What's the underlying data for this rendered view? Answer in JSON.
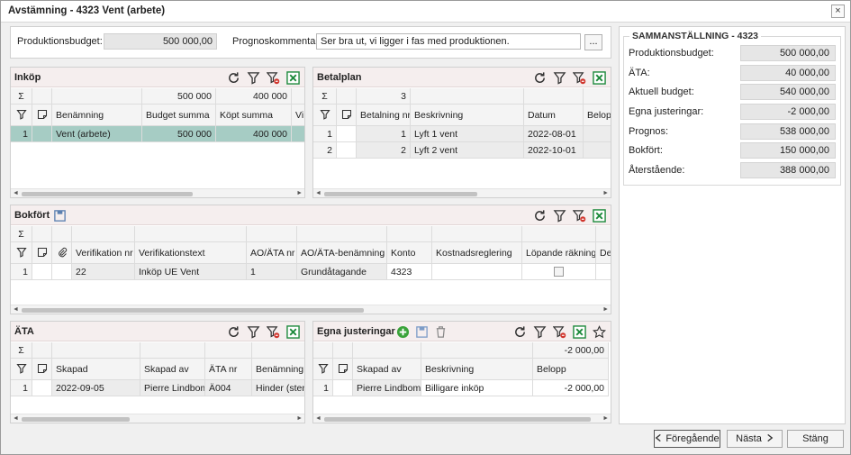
{
  "window": {
    "title": "Avstämning - 4323 Vent (arbete)",
    "close": "×"
  },
  "top": {
    "budget_label": "Produktionsbudget:",
    "budget_value": "500 000,00",
    "comment_label": "Prognoskommentar:",
    "comment_value": "Ser bra ut, vi ligger i fas med produktionen.",
    "dots": "..."
  },
  "inkop": {
    "title": "Inköp",
    "sums": {
      "budget": "500 000",
      "kopt": "400 000"
    },
    "headers": [
      "Benämning",
      "Budget summa",
      "Köpt summa",
      "Vi"
    ],
    "rows": [
      {
        "n": "1",
        "benamning": "Vent (arbete)",
        "budget": "500 000",
        "kopt": "400 000"
      }
    ]
  },
  "betalplan": {
    "title": "Betalplan",
    "count": "3",
    "headers": [
      "Betalning nr",
      "Beskrivning",
      "Datum",
      "Belop"
    ],
    "rows": [
      {
        "n": "1",
        "nr": "1",
        "besk": "Lyft 1 vent",
        "datum": "2022-08-01"
      },
      {
        "n": "2",
        "nr": "2",
        "besk": "Lyft 2 vent",
        "datum": "2022-10-01"
      }
    ]
  },
  "bokfort": {
    "title": "Bokfört",
    "headers": [
      "Verifikation nr",
      "Verifikationstext",
      "AO/ÄTA nr",
      "AO/ÄTA-benämning",
      "Konto",
      "Kostnadsreglering",
      "Löpande räkning",
      "De"
    ],
    "rows": [
      {
        "n": "1",
        "verifikation": "22",
        "text": "Inköp UE Vent",
        "ao": "1",
        "aoben": "Grundåtagande",
        "konto": "4323"
      }
    ]
  },
  "ata": {
    "title": "ÄTA",
    "headers": [
      "Skapad",
      "Skapad av",
      "ÄTA nr",
      "Benämning"
    ],
    "rows": [
      {
        "n": "1",
        "skapad": "2022-09-05",
        "av": "Pierre Lindbom",
        "nr": "Ä004",
        "ben": "Hinder (sten)"
      }
    ]
  },
  "egna": {
    "title": "Egna justeringar",
    "sum": "-2 000,00",
    "headers": [
      "Skapad av",
      "Beskrivning",
      "Belopp"
    ],
    "rows": [
      {
        "n": "1",
        "av": "Pierre Lindbom",
        "besk": "Billigare inköp",
        "belopp": "-2 000,00"
      }
    ]
  },
  "summary": {
    "title": "SAMMANSTÄLLNING - 4323",
    "rows": [
      {
        "label": "Produktionsbudget:",
        "value": "500 000,00"
      },
      {
        "label": "ÄTA:",
        "value": "40 000,00"
      },
      {
        "label": "Aktuell budget:",
        "value": "540 000,00"
      },
      {
        "label": "Egna justeringar:",
        "value": "-2 000,00"
      },
      {
        "label": "Prognos:",
        "value": "538 000,00"
      },
      {
        "label": "Bokfört:",
        "value": "150 000,00"
      },
      {
        "label": "Återstående:",
        "value": "388 000,00"
      }
    ]
  },
  "buttons": {
    "prev": "Föregående",
    "next": "Nästa",
    "close": "Stäng"
  },
  "sigma": "Σ",
  "colors": {
    "selected_row": "#a6ccc4",
    "title_bg": "#f5eeee",
    "excel_green": "#1e8a3c",
    "refresh_blue": "#333333",
    "filter_red": "#d0342c",
    "add_green": "#3aa33a"
  },
  "icons": [
    "refresh-icon",
    "filter-icon",
    "clear-filter-icon",
    "excel-icon",
    "save-icon",
    "add-icon",
    "delete-icon",
    "star-icon",
    "note-icon",
    "paperclip-icon",
    "chevron-left-icon",
    "chevron-right-icon",
    "sigma-icon"
  ]
}
